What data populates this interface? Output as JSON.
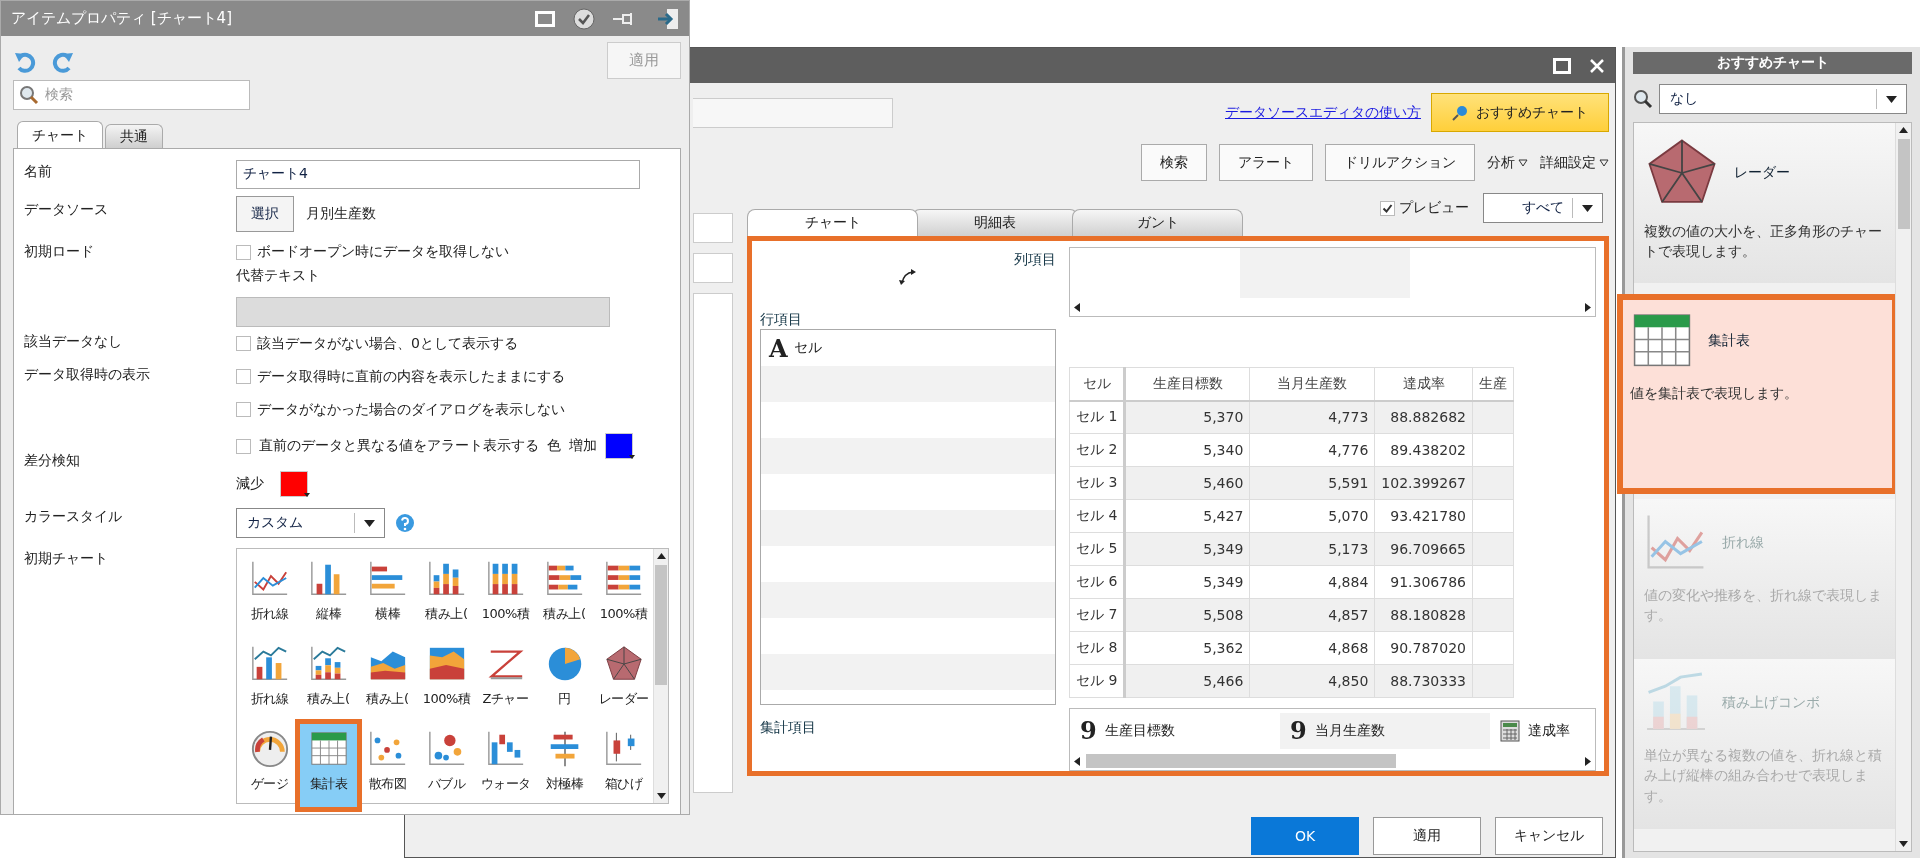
{
  "property_panel": {
    "title": "アイテムプロパティ [チャート4]",
    "apply_button": "適用",
    "search": {
      "placeholder": "検索"
    },
    "tabs": [
      {
        "label": "チャート",
        "selected": true
      },
      {
        "label": "共通",
        "selected": false
      }
    ],
    "name": {
      "label": "名前",
      "value": "チャート4"
    },
    "data_source": {
      "label": "データソース",
      "button": "選択",
      "value": "月別生産数"
    },
    "initial_load": {
      "label": "初期ロード",
      "option": {
        "label": "ボードオープン時にデータを取得しない",
        "checked": false
      },
      "alt_text_label": "代替テキスト",
      "alt_text_disabled": true
    },
    "no_data": {
      "label": "該当データなし",
      "option": {
        "label": "該当データがない場合、0として表示する",
        "checked": false
      }
    },
    "fetch_display": {
      "label": "データ取得時の表示",
      "options": [
        {
          "label": "データ取得時に直前の内容を表示したままにする",
          "checked": false
        },
        {
          "label": "データがなかった場合のダイアログを表示しない",
          "checked": false
        }
      ]
    },
    "diff_detection": {
      "label": "差分検知",
      "option": {
        "label": "直前のデータと異なる値をアラート表示する",
        "checked": false
      },
      "color_label": "色",
      "swatches": [
        {
          "label": "増加",
          "color": "#0000ff"
        },
        {
          "label": "減少",
          "color": "#ff0000"
        }
      ]
    },
    "color_style": {
      "label": "カラースタイル",
      "value": "カスタム"
    },
    "initial_chart": {
      "label": "初期チャート",
      "items": [
        {
          "label": "折れ線",
          "kind": "line",
          "selected": false
        },
        {
          "label": "縦棒",
          "kind": "column",
          "selected": false
        },
        {
          "label": "横棒",
          "kind": "bar",
          "selected": false
        },
        {
          "label": "積み上(",
          "kind": "stacked-column",
          "selected": false
        },
        {
          "label": "100%積",
          "kind": "percent-column",
          "selected": false
        },
        {
          "label": "積み上(",
          "kind": "stacked-bar",
          "selected": false
        },
        {
          "label": "100%積",
          "kind": "percent-bar",
          "selected": false
        },
        {
          "label": "折れ線",
          "kind": "line-column",
          "selected": false
        },
        {
          "label": "積み上(",
          "kind": "line-stacked",
          "selected": false
        },
        {
          "label": "積み上(",
          "kind": "area",
          "selected": false
        },
        {
          "label": "100%積",
          "kind": "percent-area",
          "selected": false
        },
        {
          "label": "Zチャー",
          "kind": "z",
          "selected": false
        },
        {
          "label": "円",
          "kind": "pie",
          "selected": false
        },
        {
          "label": "レーダー",
          "kind": "radar",
          "selected": false
        },
        {
          "label": "ゲージ",
          "kind": "gauge",
          "selected": false
        },
        {
          "label": "集計表",
          "kind": "table",
          "selected": true
        },
        {
          "label": "散布図",
          "kind": "scatter",
          "selected": false
        },
        {
          "label": "バブル",
          "kind": "bubble",
          "selected": false
        },
        {
          "label": "ウォータ",
          "kind": "waterfall",
          "selected": false
        },
        {
          "label": "対極棒",
          "kind": "bipolar",
          "selected": false
        },
        {
          "label": "箱ひげ",
          "kind": "boxplot",
          "selected": false
        }
      ]
    }
  },
  "editor": {
    "help_link": "データソースエディタの使い方",
    "recommend_button": "おすすめチャート",
    "toolbar_buttons": [
      "検索",
      "アラート",
      "ドリルアクション"
    ],
    "menus": [
      "分析",
      "詳細設定"
    ],
    "preview": {
      "label": "プレビュー",
      "checked": true
    },
    "filter": "すべて",
    "tabs": [
      {
        "label": "チャート",
        "selected": true
      },
      {
        "label": "明細表",
        "selected": false
      },
      {
        "label": "ガント",
        "selected": false
      }
    ],
    "column_label": "列項目",
    "row_label": "行項目",
    "row_items": [
      {
        "icon": "A",
        "label": "セル"
      }
    ],
    "aggregate_label": "集計項目",
    "table": {
      "columns": [
        "セル",
        "生産目標数",
        "当月生産数",
        "達成率",
        "生産"
      ],
      "rows": [
        [
          "セル 1",
          "5,370",
          "4,773",
          "88.882682"
        ],
        [
          "セル 2",
          "5,340",
          "4,776",
          "89.438202"
        ],
        [
          "セル 3",
          "5,460",
          "5,591",
          "102.399267"
        ],
        [
          "セル 4",
          "5,427",
          "5,070",
          "93.421780"
        ],
        [
          "セル 5",
          "5,349",
          "5,173",
          "96.709665"
        ],
        [
          "セル 6",
          "5,349",
          "4,884",
          "91.306786"
        ],
        [
          "セル 7",
          "5,508",
          "4,857",
          "88.180828"
        ],
        [
          "セル 8",
          "5,362",
          "4,868",
          "90.787020"
        ],
        [
          "セル 9",
          "5,466",
          "4,850",
          "88.730333"
        ]
      ]
    },
    "aggregates": [
      {
        "kind": "number",
        "icon": "9",
        "label": "生産目標数"
      },
      {
        "kind": "number",
        "icon": "9",
        "label": "当月生産数"
      },
      {
        "kind": "formula",
        "label": "達成率"
      }
    ],
    "buttons": [
      {
        "label": "OK",
        "primary": true
      },
      {
        "label": "適用",
        "primary": false
      },
      {
        "label": "キャンセル",
        "primary": false
      }
    ]
  },
  "recommend_panel": {
    "title": "おすすめチャート",
    "search_value": "なし",
    "cards": [
      {
        "kind": "radar",
        "title": "レーダー",
        "description": "複数の値の大小を、正多角形のチャートで表現します。",
        "selected": false,
        "disabled": false
      },
      {
        "kind": "table",
        "title": "集計表",
        "description": "値を集計表で表現します。",
        "selected": true,
        "disabled": false
      },
      {
        "kind": "line",
        "title": "折れ線",
        "description": "値の変化や推移を、折れ線で表現します。",
        "selected": false,
        "disabled": true
      },
      {
        "kind": "combo",
        "title": "積み上げコンボ",
        "description": "単位が異なる複数の値を、折れ線と積み上げ縦棒の組み合わせで表現します。",
        "selected": false,
        "disabled": true
      }
    ]
  }
}
